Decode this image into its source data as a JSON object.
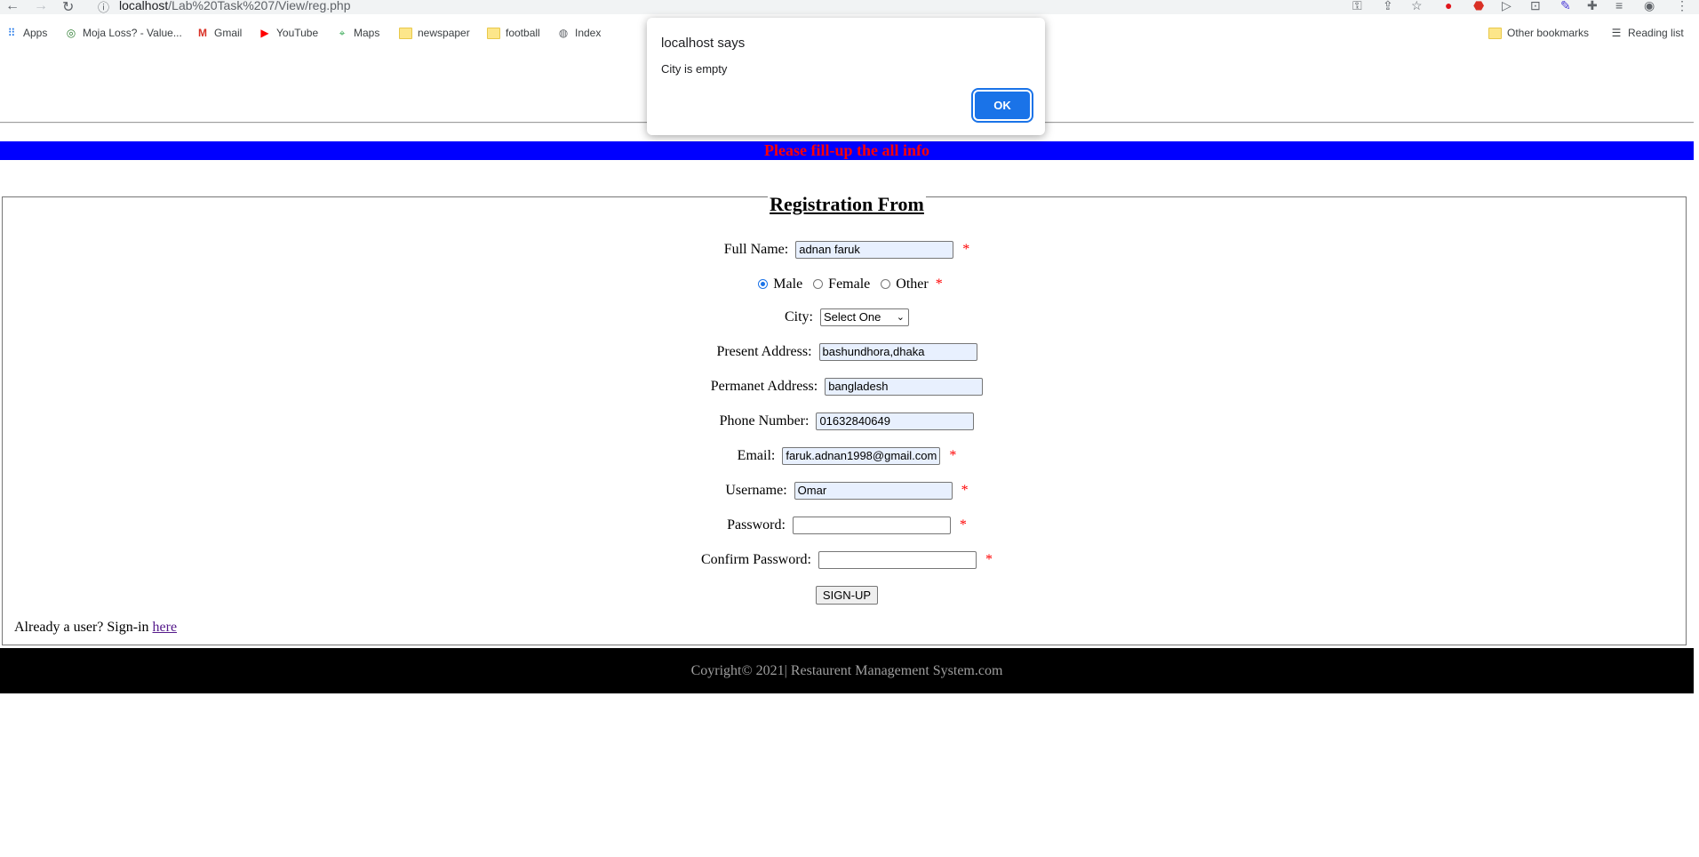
{
  "browser": {
    "url_host": "localhost",
    "url_path": "/Lab%20Task%207/View/reg.php",
    "bookmarks": [
      {
        "label": "Apps",
        "icon": "apps-grid-icon"
      },
      {
        "label": "Moja Loss? - Value...",
        "icon": "site-icon"
      },
      {
        "label": "Gmail",
        "icon": "gmail-icon"
      },
      {
        "label": "YouTube",
        "icon": "youtube-icon"
      },
      {
        "label": "Maps",
        "icon": "maps-icon"
      },
      {
        "label": "newspaper",
        "icon": "folder-icon"
      },
      {
        "label": "football",
        "icon": "folder-icon"
      },
      {
        "label": "Index",
        "icon": "globe-icon"
      }
    ],
    "other_bookmarks": "Other bookmarks",
    "reading_list": "Reading list"
  },
  "page": {
    "banner": "Please fill-up the all info",
    "form_title": "Registration From",
    "fields": {
      "full_name": {
        "label": "Full Name:",
        "value": "adnan faruk"
      },
      "gender": {
        "options": [
          "Male",
          "Female",
          "Other"
        ],
        "selected": "Male"
      },
      "city": {
        "label": "City:",
        "value": "Select One"
      },
      "present_address": {
        "label": "Present Address:",
        "value": "bashundhora,dhaka"
      },
      "permanent_address": {
        "label": "Permanet Address:",
        "value": "bangladesh"
      },
      "phone": {
        "label": "Phone Number:",
        "value": "01632840649"
      },
      "email": {
        "label": "Email:",
        "value": "faruk.adnan1998@gmail.com"
      },
      "username": {
        "label": "Username:",
        "value": "Omar"
      },
      "password": {
        "label": "Password:",
        "value": ""
      },
      "confirm_password": {
        "label": "Confirm Password:",
        "value": ""
      }
    },
    "required_mark": "*",
    "signup_button": "SIGN-UP",
    "signin_text": "Already a user? Sign-in",
    "signin_link": "here",
    "footer": "Coyright© 2021| Restaurent Management System.com"
  },
  "dialog": {
    "title": "localhost says",
    "message": "City is empty",
    "ok_label": "OK"
  },
  "colors": {
    "banner_bg": "#0000ff",
    "banner_text": "#ff0000",
    "accent": "#1a73e8",
    "footer_bg": "#000000"
  }
}
